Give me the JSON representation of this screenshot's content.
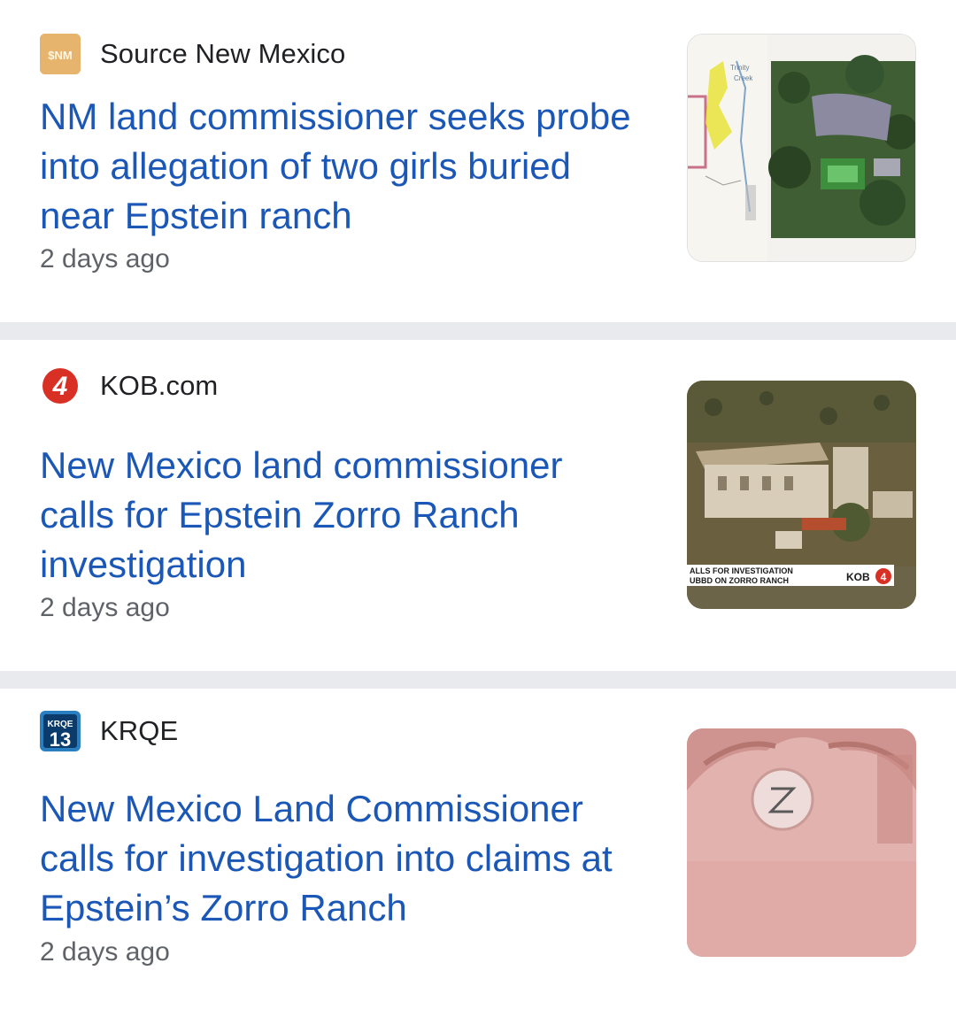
{
  "articles": [
    {
      "source": "Source New Mexico",
      "source_logo_icon": "source-nm-logo-icon",
      "headline": "NM land commissioner seeks probe into allegation of two girls buried near Epstein ranch",
      "time": "2 days ago"
    },
    {
      "source": "KOB.com",
      "source_logo_icon": "kob-4-logo-icon",
      "headline": "New Mexico land commissioner calls for Epstein Zorro Ranch investigation",
      "time": "2 days ago"
    },
    {
      "source": "KRQE",
      "source_logo_icon": "krqe-13-logo-icon",
      "headline": "New Mexico Land Commissioner calls for investigation into claims at Epstein’s Zorro Ranch",
      "time": "2 days ago"
    }
  ],
  "colors": {
    "headline": "#1a57b7",
    "source": "#202124",
    "time": "#5f6368",
    "divider": "#e8eaed"
  }
}
